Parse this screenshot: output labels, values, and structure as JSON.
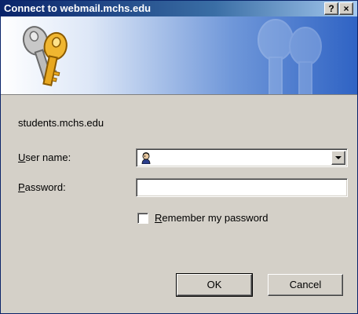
{
  "window": {
    "title": "Connect to webmail.mchs.edu"
  },
  "titlebar": {
    "help_label": "?",
    "close_label": "×"
  },
  "dialog": {
    "server": "students.mchs.edu",
    "user_label_hotkey": "U",
    "user_label_rest": "ser name:",
    "pass_label_hotkey": "P",
    "pass_label_rest": "assword:",
    "username_value": "",
    "password_value": "",
    "remember_hotkey": "R",
    "remember_rest": "emember my password",
    "remember_checked": false
  },
  "buttons": {
    "ok": "OK",
    "cancel": "Cancel"
  },
  "icons": {
    "banner": "keys-icon",
    "user": "user-avatar-icon"
  }
}
